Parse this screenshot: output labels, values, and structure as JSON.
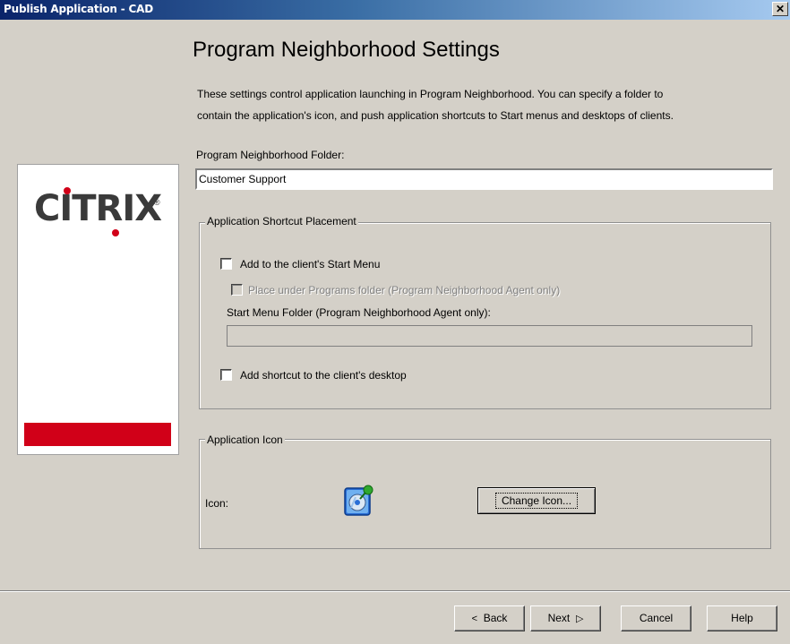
{
  "window": {
    "title": "Publish Application - CAD",
    "close_glyph": "✕"
  },
  "logo": {
    "wordmark": "CITRIX",
    "registered": "®",
    "brand_color": "#d10018"
  },
  "page": {
    "title": "Program Neighborhood Settings",
    "description_line1": "These settings control application launching in Program Neighborhood.  You can specify a folder to",
    "description_line2": "contain the application's icon, and push application shortcuts to Start menus and desktops of clients."
  },
  "folder": {
    "label": "Program Neighborhood Folder:",
    "value": "Customer Support"
  },
  "shortcut_placement": {
    "legend": "Application Shortcut Placement",
    "add_start_menu_label": "Add to the client's Start Menu",
    "add_start_menu_checked": false,
    "place_under_programs_label": "Place under Programs folder (Program Neighborhood Agent only)",
    "place_under_programs_checked": false,
    "start_menu_folder_label": "Start Menu Folder (Program Neighborhood Agent only):",
    "start_menu_folder_value": "",
    "add_desktop_label": "Add shortcut to the client's desktop",
    "add_desktop_checked": false
  },
  "application_icon": {
    "legend": "Application Icon",
    "icon_label": "Icon:",
    "icon_name": "application-cd-pushpin-icon",
    "change_button": "Change Icon..."
  },
  "footer": {
    "back": "Back",
    "next": "Next",
    "cancel": "Cancel",
    "help": "Help"
  }
}
